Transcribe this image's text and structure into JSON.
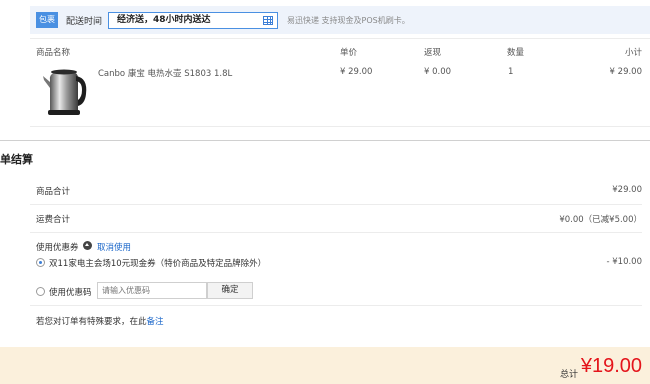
{
  "delivery": {
    "package_tag": "包裹",
    "time_label": "配送时间",
    "time_value": "经济送，48小时内送达",
    "tip": "易迅快递 支持现金及POS机刷卡。"
  },
  "table": {
    "headers": {
      "name": "商品名称",
      "unit_price": "单价",
      "cashback": "返现",
      "quantity": "数量",
      "subtotal": "小计"
    },
    "items": [
      {
        "name": "Canbo 康宝 电热水壶 S1803 1.8L",
        "unit_price": "¥ 29.00",
        "cashback": "¥ 0.00",
        "quantity": "1",
        "subtotal": "¥ 29.00",
        "image": "electric-kettle"
      }
    ]
  },
  "settlement": {
    "title": "单结算",
    "goods_total_label": "商品合计",
    "goods_total_value": "¥29.00",
    "shipping_label": "运费合计",
    "shipping_value": "¥0.00（已减¥5.00）",
    "coupon_label": "使用优惠券",
    "coupon_cancel": "取消使用",
    "coupon_option": "双11家电主会场10元现金券（特价商品及特定品牌除外）",
    "coupon_discount": "- ¥10.00",
    "code_label": "使用优惠码",
    "code_placeholder": "请输入优惠码",
    "confirm_label": "确定",
    "remark_prefix": "若您对订单有特殊要求，在此",
    "remark_link": "备注"
  },
  "total": {
    "label": "总计",
    "amount": "¥19.00",
    "color": "#e4141b"
  },
  "colors": {
    "accent": "#4a90e2",
    "link": "#1a66c9",
    "total_bg": "#fbf0dc"
  }
}
